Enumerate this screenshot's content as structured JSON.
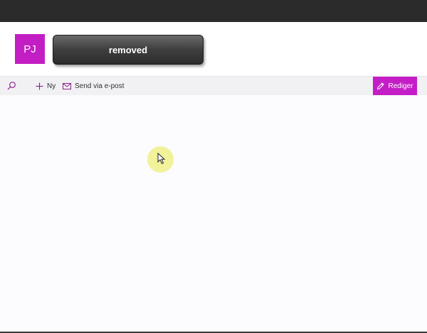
{
  "header": {
    "avatar_initials": "PJ",
    "redacted_label": "removed"
  },
  "commandbar": {
    "search_icon": "search-icon",
    "new_label": "Ny",
    "email_label": "Send via e-post",
    "edit_label": "Rediger"
  },
  "colors": {
    "accent": "#c41dc7",
    "topbar": "#2b2b2b",
    "cursor_highlight": "#f1f29a"
  }
}
